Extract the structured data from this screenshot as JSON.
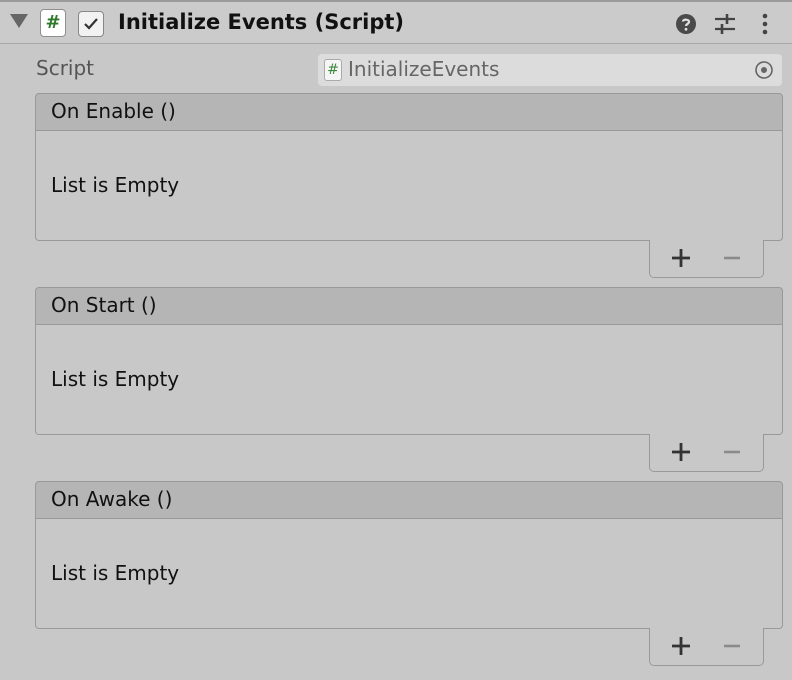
{
  "component": {
    "title": "Initialize Events (Script)",
    "enabled": true,
    "script_icon": "#",
    "icons": [
      "foldout-arrow-icon",
      "script-icon",
      "checkbox-icon",
      "help-icon",
      "preset-icon",
      "more-options-icon"
    ]
  },
  "script_field": {
    "label": "Script",
    "value": "InitializeEvents",
    "icon": "#"
  },
  "events": [
    {
      "header": "On Enable ()",
      "body": "List is Empty"
    },
    {
      "header": "On Start ()",
      "body": "List is Empty"
    },
    {
      "header": "On Awake ()",
      "body": "List is Empty"
    }
  ],
  "colors": {
    "background": "#c8c8c8",
    "header_bg": "#b5b5b5",
    "script_green": "#2d7a2d"
  }
}
